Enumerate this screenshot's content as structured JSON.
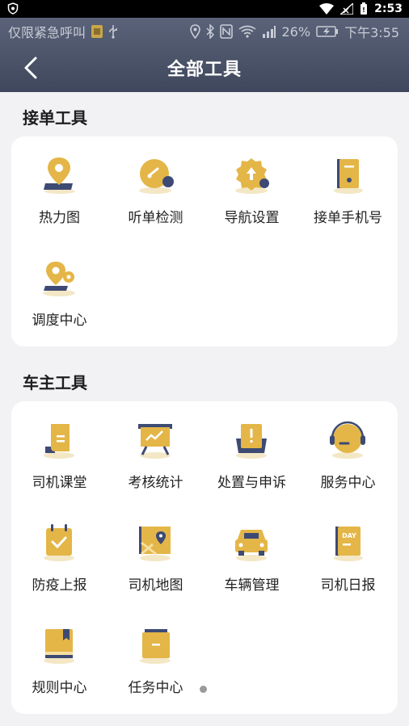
{
  "system_bar": {
    "time": "2:53"
  },
  "status_row": {
    "emergency_text": "仅限紧急呼叫",
    "battery": "26%",
    "time": "下午3:55"
  },
  "header": {
    "title": "全部工具"
  },
  "sections": [
    {
      "title": "接单工具",
      "items": [
        {
          "label": "热力图",
          "icon": "heatmap-pin-icon"
        },
        {
          "label": "听单检测",
          "icon": "gauge-icon"
        },
        {
          "label": "导航设置",
          "icon": "nav-gear-icon"
        },
        {
          "label": "接单手机号",
          "icon": "phone-card-icon"
        },
        {
          "label": "调度中心",
          "icon": "dispatch-pin-icon"
        }
      ]
    },
    {
      "title": "车主工具",
      "items": [
        {
          "label": "司机课堂",
          "icon": "classroom-book-icon"
        },
        {
          "label": "考核统计",
          "icon": "board-chart-icon"
        },
        {
          "label": "处置与申诉",
          "icon": "appeal-folder-icon"
        },
        {
          "label": "服务中心",
          "icon": "headset-icon"
        },
        {
          "label": "防疫上报",
          "icon": "calendar-check-icon"
        },
        {
          "label": "司机地图",
          "icon": "map-icon"
        },
        {
          "label": "车辆管理",
          "icon": "car-icon"
        },
        {
          "label": "司机日报",
          "icon": "day-report-icon"
        },
        {
          "label": "规则中心",
          "icon": "rule-book-icon"
        },
        {
          "label": "任务中心",
          "icon": "task-box-icon"
        }
      ]
    }
  ],
  "colors": {
    "header_top": "#5a6379",
    "header_bottom": "#3f475c",
    "icon_gold": "#e4b648",
    "icon_navy": "#3d4a73"
  }
}
